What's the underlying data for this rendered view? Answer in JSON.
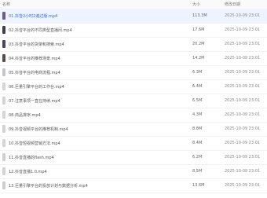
{
  "header": {
    "name": "名称",
    "size": "大小",
    "date": "修改日期"
  },
  "files": [
    {
      "name": "01.抖音2小时2遍过版.mp4",
      "size": "113.3M",
      "date": "2025-10-09 23:01",
      "thumb_color": "#6b5a8c"
    },
    {
      "name": "02.抖音平台的不同类型直播间.mp4",
      "size": "17.6M",
      "date": "2025-10-09 23:01",
      "thumb_color": "#3a3f4f"
    },
    {
      "name": "03.抖音平台的货架和搜索.mp4",
      "size": "20.2M",
      "date": "2025-10-09 23:01",
      "thumb_color": "#4a4560"
    },
    {
      "name": "04.抖音平台的推荐场景.mp4",
      "size": "14.2M",
      "date": "2025-10-09 23:01",
      "thumb_color": "#5c4b44"
    },
    {
      "name": "05.抖音平台的电商流程.mp4",
      "size": "6.3M",
      "date": "2025-10-09 23:01",
      "thumb_color": "#c9c2cf"
    },
    {
      "name": "06.巨量引擎平台的工作台.mp4",
      "size": "6.4M",
      "date": "2025-10-09 23:01",
      "thumb_color": "#d6d3da"
    },
    {
      "name": "07.注意事项一直在持续.mp4",
      "size": "6.5M",
      "date": "2025-10-09 23:01",
      "thumb_color": "#d4d0d8"
    },
    {
      "name": "08.商品排序.mp4",
      "size": "4.3M",
      "date": "2025-10-09 23:01",
      "thumb_color": "#d8d4dc"
    },
    {
      "name": "09.抖音视频平台的推荐机制.mp4",
      "size": "8.8M",
      "date": "2025-10-09 23:01",
      "thumb_color": "#d2cfd6"
    },
    {
      "name": "10.抖音短视频营销方法.mp4",
      "size": "8.4M",
      "date": "2025-10-09 23:01",
      "thumb_color": "#d6d2da"
    },
    {
      "name": "11.抖音直播的flash.mp4",
      "size": "6.2M",
      "date": "2025-10-09 23:01",
      "thumb_color": "#d0ccd4"
    },
    {
      "name": "12.抖音直播1.0.mp4",
      "size": "8.5M",
      "date": "2025-10-09 23:01",
      "thumb_color": "#d4d1d8"
    },
    {
      "name": "13.巨量引擎平台的投放计划与数据分析.mp4",
      "size": "13.6M",
      "date": "2025-10-09 23:01",
      "thumb_color": "#cfcbd3"
    }
  ]
}
